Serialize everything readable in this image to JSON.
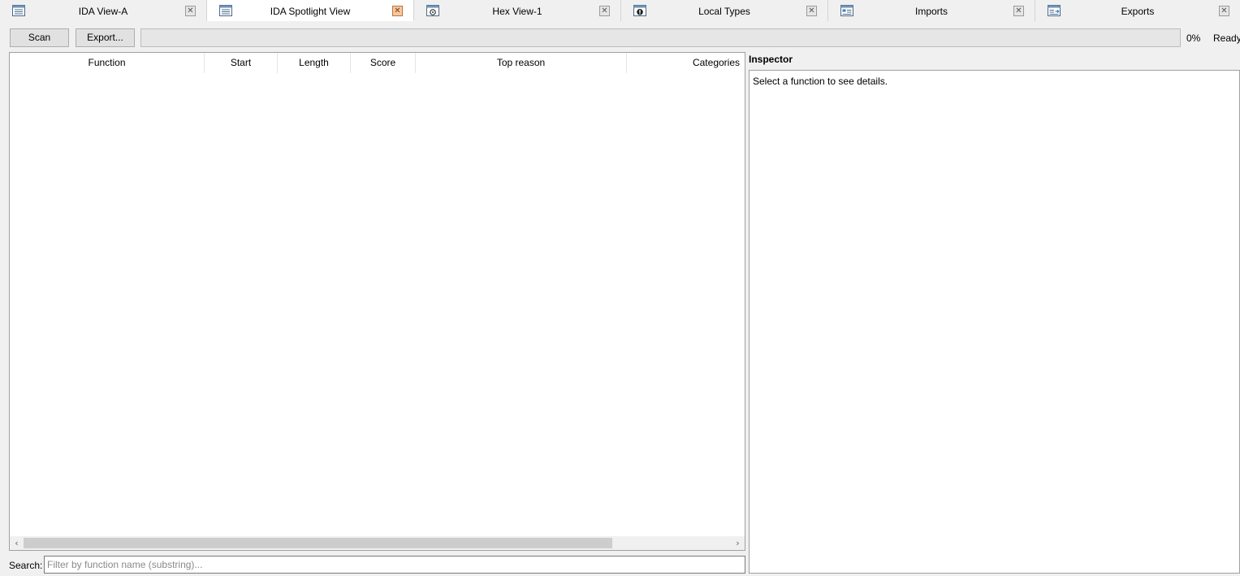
{
  "tabs": [
    {
      "label": "IDA View-A",
      "icon": "disassembly-icon",
      "active": false
    },
    {
      "label": "IDA Spotlight View",
      "icon": "disassembly-icon",
      "active": true
    },
    {
      "label": "Hex View-1",
      "icon": "hex-view-icon",
      "active": false
    },
    {
      "label": "Local Types",
      "icon": "local-types-icon",
      "active": false
    },
    {
      "label": "Imports",
      "icon": "imports-icon",
      "active": false
    },
    {
      "label": "Exports",
      "icon": "exports-icon",
      "active": false
    }
  ],
  "tab_close_glyph": "✕",
  "toolbar": {
    "scan_label": "Scan",
    "export_label": "Export...",
    "progress_percent": 0,
    "progress_text": "0%",
    "status": "Ready"
  },
  "table": {
    "columns": [
      "Function",
      "Start",
      "Length",
      "Score",
      "Top reason",
      "Categories"
    ],
    "rows": [],
    "scroll_left_glyph": "‹",
    "scroll_right_glyph": "›"
  },
  "search": {
    "label": "Search:",
    "value": "",
    "placeholder": "Filter by function name (substring)..."
  },
  "inspector": {
    "title": "Inspector",
    "placeholder_text": "Select a function to see details."
  },
  "colors": {
    "background": "#f0f0f0",
    "panel": "#ffffff",
    "active_close": "#f5c9a2",
    "progress_fill": "#06b025"
  }
}
